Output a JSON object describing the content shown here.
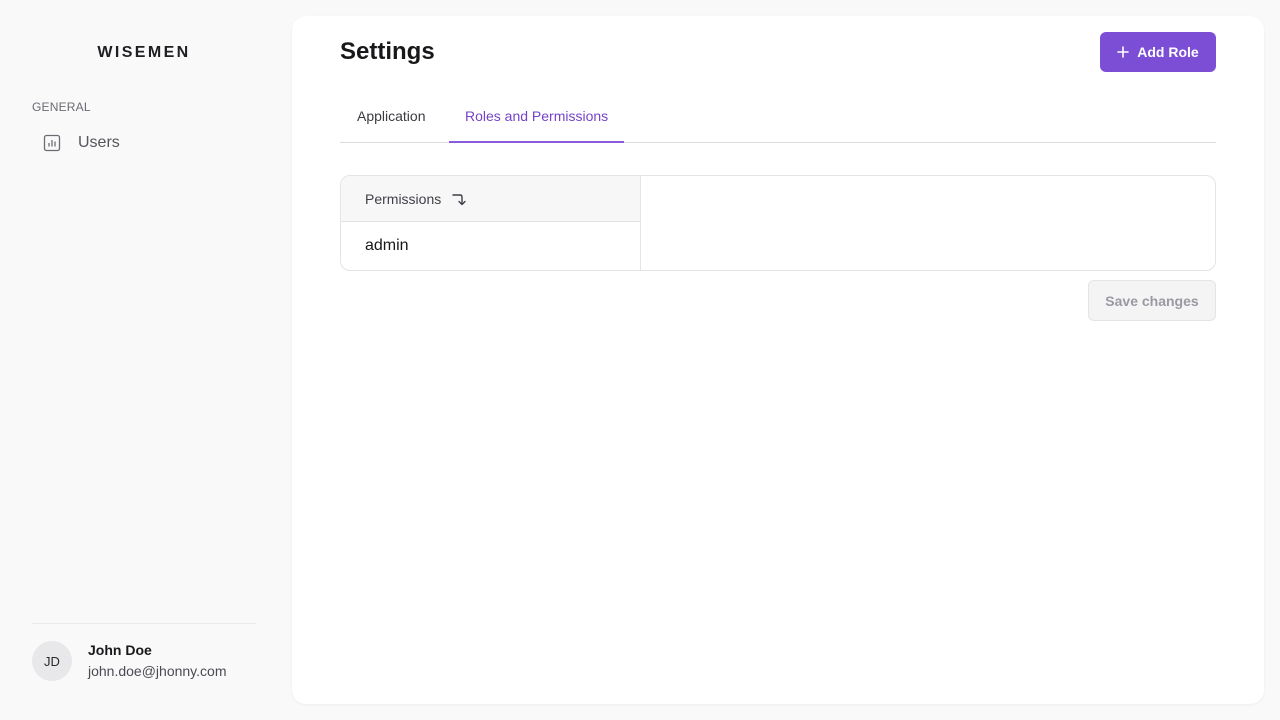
{
  "app": {
    "brand": "WISEMEN"
  },
  "sidebar": {
    "section_label": "GENERAL",
    "items": [
      {
        "label": "Users",
        "icon": "bar-chart-icon"
      }
    ]
  },
  "user": {
    "initials": "JD",
    "name": "John Doe",
    "email": "john.doe@jhonny.com"
  },
  "header": {
    "title": "Settings",
    "add_role_label": "Add Role",
    "add_role_icon": "plus-icon"
  },
  "tabs": [
    {
      "label": "Application",
      "active": false
    },
    {
      "label": "Roles and Permissions",
      "active": true
    }
  ],
  "table": {
    "columns": [
      {
        "label": "Permissions",
        "sort_icon": "sort-arrow-icon"
      }
    ],
    "rows": [
      {
        "cells": [
          "admin"
        ]
      }
    ]
  },
  "actions": {
    "save_label": "Save changes",
    "save_enabled": false
  },
  "colors": {
    "accent": "#7c4ed6",
    "tab_active": "#7443c9",
    "background": "#f9f9f9",
    "card": "#ffffff"
  }
}
